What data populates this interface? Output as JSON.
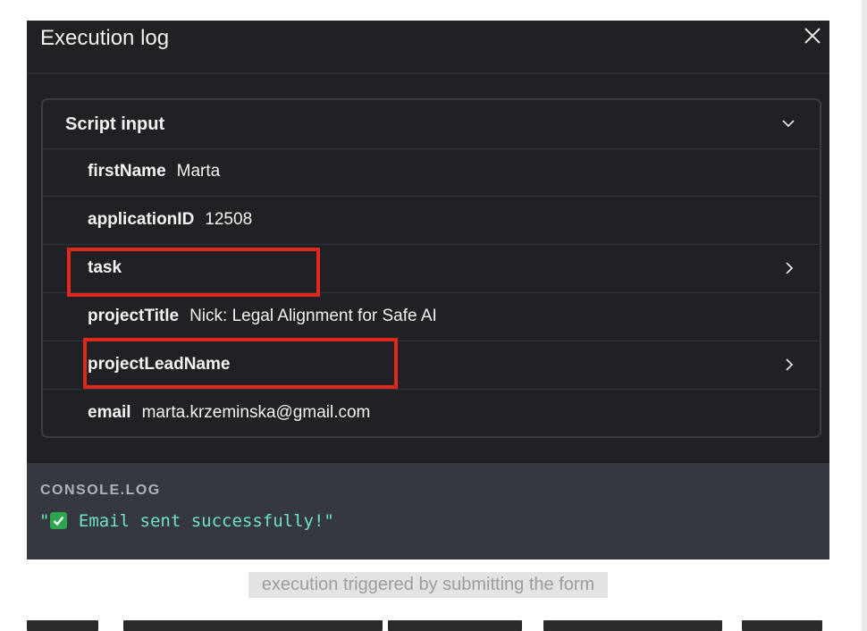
{
  "modal": {
    "title": "Execution log",
    "close_icon": "close-icon"
  },
  "script_input": {
    "title": "Script input",
    "toggle_icon": "chevron-down-icon",
    "rows": [
      {
        "key": "firstName",
        "value": "Marta"
      },
      {
        "key": "applicationID",
        "value": "12508"
      },
      {
        "key": "task",
        "value": "",
        "expandable": true,
        "highlighted": true
      },
      {
        "key": "projectTitle",
        "value": "Nick: Legal Alignment for Safe AI"
      },
      {
        "key": "projectLeadName",
        "value": "",
        "expandable": true,
        "highlighted": true
      },
      {
        "key": "email",
        "value": "marta.krzeminska@gmail.com"
      }
    ]
  },
  "console": {
    "label": "CONSOLE.LOG",
    "quote_open": "\"",
    "message": " Email sent successfully!\"",
    "emoji": "check-mark-button-icon"
  },
  "caption": "execution triggered by submitting the form",
  "colors": {
    "panel_bg": "#1f2124",
    "console_bg": "#35383f",
    "console_text": "#6fe3c3",
    "highlight": "#e0281b"
  }
}
